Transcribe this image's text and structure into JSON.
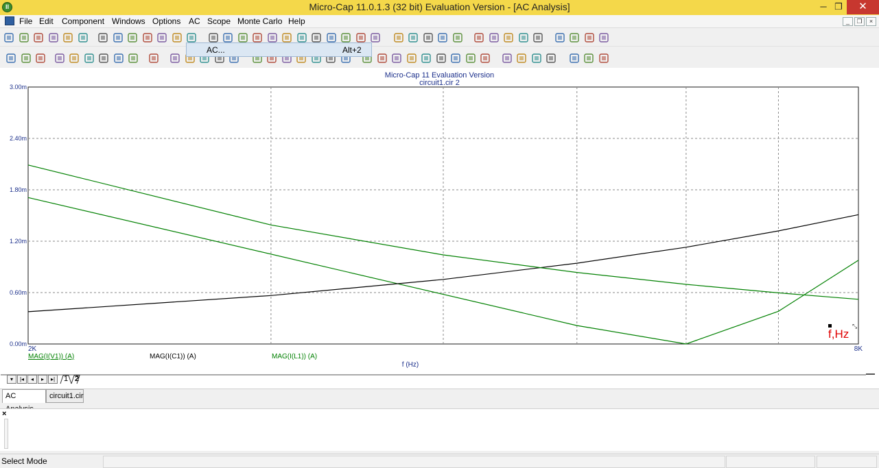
{
  "window": {
    "title": "Micro-Cap 11.0.1.3 (32 bit) Evaluation Version - [AC Analysis]",
    "minimize_glyph": "─",
    "restore_glyph": "❐",
    "close_glyph": "✕",
    "app_icon_glyph": "II"
  },
  "menu": {
    "items": [
      "File",
      "Edit",
      "Component",
      "Windows",
      "Options",
      "AC",
      "Scope",
      "Monte Carlo",
      "Help"
    ],
    "mdi_controls": [
      "_",
      "❐",
      "×"
    ]
  },
  "dropdown": {
    "label": "AC...",
    "shortcut": "Alt+2"
  },
  "toolbar1_icons": [
    "new-file-icon",
    "open-folder-icon",
    "save-icon",
    "save-all-icon",
    "print-preview-icon",
    "print-icon",
    "undo-icon",
    "redo-icon",
    "cut-icon",
    "copy-icon",
    "paste-icon",
    "delete-icon",
    "select-all-icon",
    "ground-icon",
    "resistor-icon",
    "capacitor-icon",
    "inductor-icon",
    "diode-icon",
    "battery-icon",
    "transistor-icon",
    "opamp-icon",
    "switch-icon",
    "capacitor-2-icon",
    "node-icon",
    "flag-icon",
    "cascade-icon",
    "tile-vertical-icon",
    "tile-horizontal-icon",
    "window-icon",
    "calculator-icon",
    "page-icon",
    "component-editor-icon",
    "globe-icon",
    "model-icon",
    "text-editor-icon",
    "shape-icon",
    "options-icon",
    "analysis-icon",
    "probe-icon"
  ],
  "toolbar2_icons": [
    "select-mode-icon",
    "component-mode-icon",
    "dropdown-icon",
    "zoom-box-icon",
    "zoom-region-icon",
    "scale-icon",
    "auto-scale-icon",
    "fx-icon",
    "text-mode-icon",
    "properties-icon",
    "run-icon",
    "stop-icon",
    "pause-icon",
    "cursor-icon",
    "cursor-2-icon",
    "grid-icon",
    "grid-2-icon",
    "grid-3-icon",
    "grid-4-icon",
    "grid-5-icon",
    "grid-6-icon",
    "grid-7-icon",
    "tokens-icon",
    "peak-icon",
    "valley-icon",
    "high-icon",
    "low-icon",
    "inflection-icon",
    "global-high-icon",
    "global-low-icon",
    "slope-icon",
    "zoom-in-icon",
    "zoom-out-icon",
    "zoom-fit-icon",
    "color-icon",
    "font-icon",
    "copy-plot-icon",
    "paste-plot-icon"
  ],
  "plot": {
    "title": "Micro-Cap 11 Evaluation Version",
    "subtitle": "circuit1.cir 2",
    "xlabel": "f (Hz)",
    "x_tick_start": "2K",
    "x_tick_end": "8K",
    "y_ticks": [
      "3.00m",
      "2.40m",
      "1.80m",
      "1.20m",
      "0.60m",
      "0.00m"
    ],
    "traces": [
      {
        "name": "MAG(I(V1)) (A)",
        "color": "#008000"
      },
      {
        "name": "MAG(I(C1)) (A)",
        "color": "#000000"
      },
      {
        "name": "MAG(I(L1)) (A)",
        "color": "#008000"
      }
    ],
    "cursor_label": "f,Hz"
  },
  "chart_data": {
    "type": "line",
    "title": "Micro-Cap 11 Evaluation Version",
    "subtitle": "circuit1.cir 2",
    "xlabel": "f (Hz)",
    "ylabel": "",
    "xlim": [
      2000,
      8000
    ],
    "ylim": [
      0,
      0.003
    ],
    "x_tick_labels": [
      "2K",
      "8K"
    ],
    "y_tick_labels": [
      "3.00m",
      "2.40m",
      "1.80m",
      "1.20m",
      "0.60m",
      "0.00m"
    ],
    "grid": true,
    "series": [
      {
        "name": "MAG(I(V1)) (A)",
        "color": "#008000",
        "x": [
          2000,
          3750,
          5000,
          6000,
          7000,
          8000
        ],
        "y": [
          0.00171,
          0.000685,
          0.000215,
          0.0,
          0.000382,
          0.000978
        ]
      },
      {
        "name": "MAG(I(C1)) (A)",
        "color": "#000000",
        "x": [
          2000,
          3000,
          4000,
          5000,
          6000,
          7000,
          8000
        ],
        "y": [
          0.000377,
          0.000566,
          0.000754,
          0.000943,
          0.00113,
          0.00132,
          0.00151
        ]
      },
      {
        "name": "MAG(I(L1)) (A)",
        "color": "#008000",
        "x": [
          2000,
          3000,
          4000,
          5000,
          6000,
          7000,
          8000
        ],
        "y": [
          0.00209,
          0.00139,
          0.00104,
          0.000835,
          0.000696,
          0.000597,
          0.000522
        ]
      }
    ]
  },
  "sheet_tabs": {
    "nav": [
      "▾",
      "|◂",
      "◂",
      "▸",
      "▸|"
    ],
    "pages": [
      "1",
      "2"
    ]
  },
  "doc_tabs": [
    "AC Analysis",
    "circuit1.cir"
  ],
  "output": {
    "close_glyph": "×"
  },
  "status": {
    "text": "Select Mode"
  }
}
